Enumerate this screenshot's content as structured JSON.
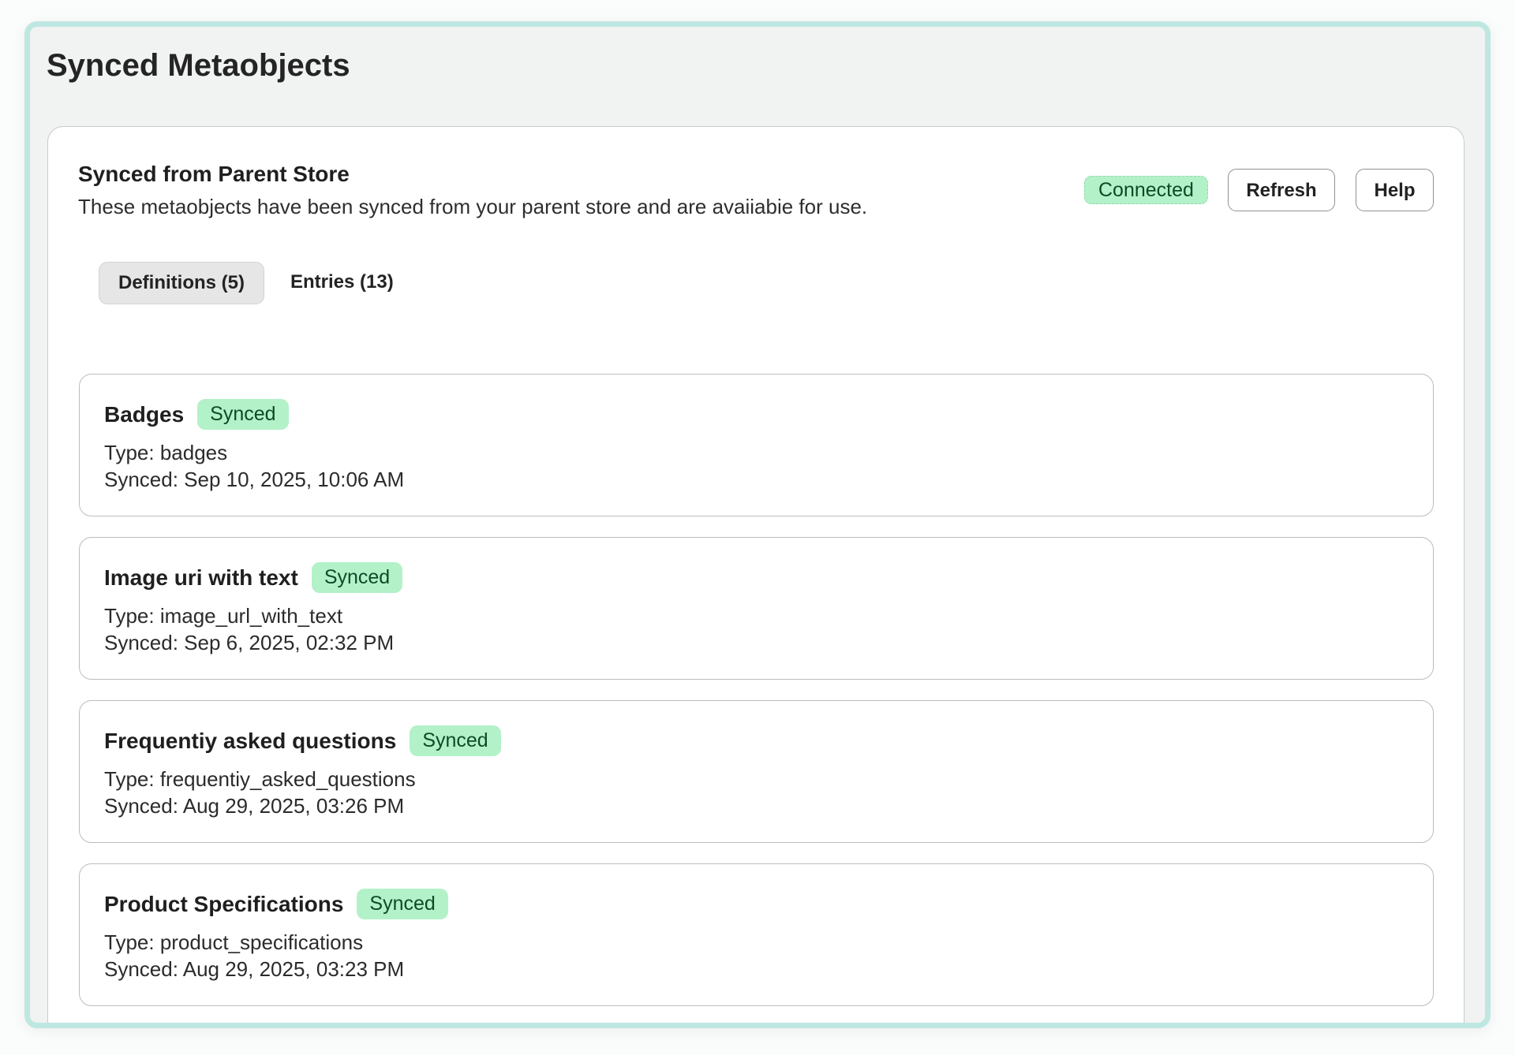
{
  "page": {
    "title": "Synced Metaobjects"
  },
  "section": {
    "title": "Synced from Parent Store",
    "description": "These metaobjects have been synced from your parent store and are avaiiabie for use.",
    "status_badge": "Connected",
    "refresh_label": "Refresh",
    "help_label": "Help"
  },
  "tabs": [
    {
      "label": "Definitions (5)",
      "selected": true
    },
    {
      "label": "Entries (13)",
      "selected": false
    }
  ],
  "definitions": [
    {
      "name": "Badges",
      "status": "Synced",
      "type": "Type: badges",
      "synced_at": "Synced: Sep 10, 2025, 10:06 AM"
    },
    {
      "name": "Image uri with text",
      "status": "Synced",
      "type": "Type: image_url_with_text",
      "synced_at": "Synced: Sep 6, 2025, 02:32 PM"
    },
    {
      "name": "Frequentiy asked questions",
      "status": "Synced",
      "type": "Type: frequentiy_asked_questions",
      "synced_at": "Synced: Aug 29, 2025, 03:26 PM"
    },
    {
      "name": "Product Specifications",
      "status": "Synced",
      "type": "Type: product_specifications",
      "synced_at": "Synced: Aug 29, 2025, 03:23 PM"
    }
  ],
  "colors": {
    "frame_border": "#bfe7e1",
    "page_background": "#f1f2f2",
    "status_green": "#b3f1c8",
    "status_text": "#0e4a28"
  }
}
